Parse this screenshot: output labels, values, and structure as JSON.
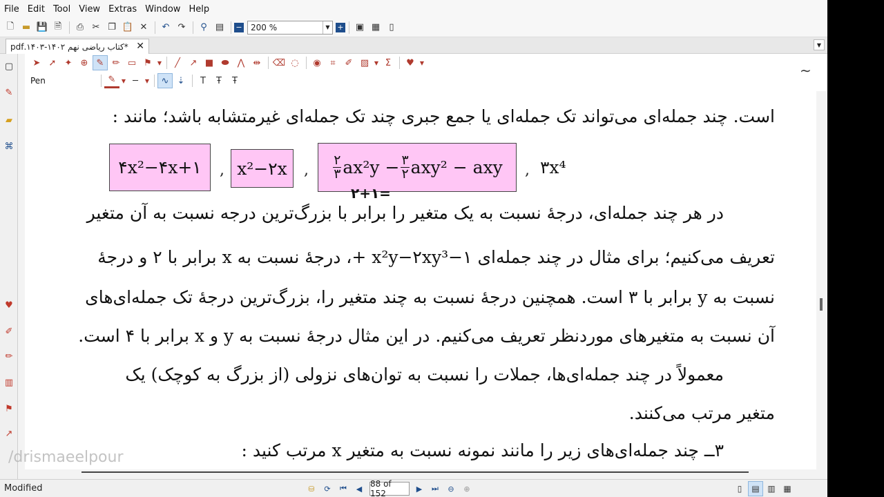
{
  "menu": [
    "File",
    "Edit",
    "Tool",
    "View",
    "Extras",
    "Window",
    "Help"
  ],
  "toolbar": {
    "zoom_value": "200 %"
  },
  "tab": {
    "title": "*کتاب ریاضی نهم ۱۴۰۲-۱۴۰۳.pdf",
    "close": "✕"
  },
  "annotation_toolbar": {
    "tool_label": "Pen"
  },
  "document": {
    "line1": "است. چند جمله‌ای می‌تواند تک جمله‌ای یا جمع جبری چند تک جمله‌ای غیرمتشابه باشد؛ مانند :",
    "box1": "۴x²−۴x+۱",
    "box2": "x²−۲x",
    "box3_num1": "۲",
    "box3_den1": "۳",
    "box3_mid1": "ax²y −",
    "box3_num2": "۳",
    "box3_den2": "۲",
    "box3_mid2": "axy² − axy",
    "mono": "۳x⁴",
    "handwriting": "۲+۱=",
    "para1": "در هر چند جمله‌ای، درجهٔ نسبت به یک متغیر را برابر با بزرگ‌ترین درجه نسبت به آن متغیر",
    "para2": "تعریف می‌کنیم؛ برای مثال در چند جمله‌ای ۱−x²y−۲xy³ +، درجهٔ نسبت به x برابر با ۲ و درجهٔ",
    "para3": "نسبت به y برابر با ۳ است. همچنین درجهٔ نسبت به چند متغیر را، بزرگ‌ترین درجهٔ تک جمله‌ای‌های",
    "para4": "آن نسبت به متغیرهای موردنظر تعریف می‌کنیم. در این مثال درجهٔ نسبت به y و x برابر با ۴ است.",
    "para5": "معمولاً در چند جمله‌ای‌ها، جملات را نسبت به توان‌های نزولی (از بزرگ به کوچک) یک",
    "para6": "متغیر مرتب می‌کنند.",
    "para7": "۳ــ چند جمله‌ای‌های زیر را مانند نمونه نسبت به متغیر x مرتب کنید :"
  },
  "watermark": "/drismaeelpour",
  "status": {
    "text": "Modified",
    "page": "88 of 152"
  },
  "colors": {
    "box_fill": "#ffc6f5",
    "accent_red": "#c0392b",
    "selection_blue": "#cfe3f7"
  },
  "icons": {
    "toolbar": [
      "new-icon",
      "open-icon",
      "save-icon",
      "save-as-icon",
      "print-icon",
      "cut-icon",
      "copy-icon",
      "paste-icon",
      "delete-icon",
      "undo-icon",
      "redo-icon",
      "binoculars-icon",
      "find-icon"
    ],
    "annotation": [
      "select-icon",
      "pointer-icon",
      "highlight-icon",
      "zoom-icon",
      "pen-icon",
      "marker-icon",
      "stamp-icon",
      "line-icon",
      "arrow-icon",
      "rect-icon",
      "ellipse-icon",
      "polygon-icon",
      "measure-icon",
      "eraser-icon",
      "lasso-icon",
      "camera-icon",
      "crop-icon",
      "ruler-icon",
      "image-icon",
      "sigma-icon",
      "heart-icon"
    ]
  }
}
